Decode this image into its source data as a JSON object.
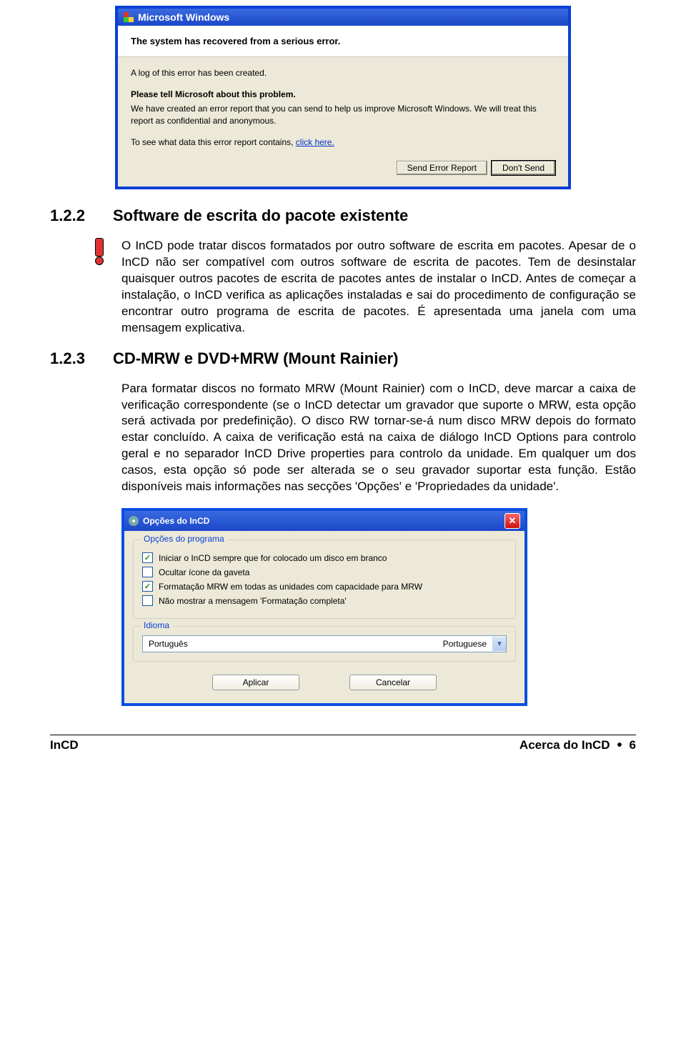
{
  "error_dialog": {
    "title": "Microsoft Windows",
    "header_bold": "The system has recovered from a serious error.",
    "log_line": "A log of this error has been created.",
    "tell_bold": "Please tell Microsoft about this problem.",
    "tell_body": "We have created an error report that you can send to help us improve Microsoft Windows.  We will treat this report as confidential and anonymous.",
    "see_prefix": "To see what data this error report contains, ",
    "see_link": "click here.",
    "btn_send": "Send Error Report",
    "btn_dont": "Don't Send"
  },
  "section_122": {
    "number": "1.2.2",
    "title": "Software de escrita do pacote existente",
    "body": "O InCD pode tratar discos formatados por outro software de escrita em pacotes. Apesar de o InCD não ser compatível com outros software de escrita de pacotes. Tem de desinstalar quaisquer outros pacotes de escrita de pacotes antes de instalar o InCD. Antes de começar a instalação, o InCD verifica as aplicações instaladas e sai do procedimento de configuração se encontrar outro programa de escrita de pacotes. É apresentada uma janela com uma mensagem explicativa."
  },
  "section_123": {
    "number": "1.2.3",
    "title": "CD-MRW e DVD+MRW (Mount Rainier)",
    "body": "Para formatar discos no formato MRW (Mount Rainier) com o InCD, deve marcar a caixa de verificação correspondente (se o InCD detectar um gravador que suporte o MRW, esta opção será activada por predefinição). O disco RW tornar-se-á num disco MRW depois do formato estar concluído. A caixa de verificação está na caixa de diálogo InCD Options para controlo geral e no separador InCD Drive properties para controlo da unidade. Em qualquer um dos casos, esta opção só pode ser alterada se o seu gravador suportar esta função. Estão disponíveis mais informações nas secções 'Opções' e 'Propriedades da unidade'."
  },
  "options_dialog": {
    "title": "Opções do InCD",
    "group_program": "Opções do programa",
    "checks": [
      {
        "label": "Iniciar o InCD sempre que for colocado um disco em branco",
        "checked": true
      },
      {
        "label": "Ocultar ícone da gaveta",
        "checked": false
      },
      {
        "label": "Formatação MRW em todas as unidades com capacidade para MRW",
        "checked": true
      },
      {
        "label": "Não mostrar a mensagem 'Formatação completa'",
        "checked": false
      }
    ],
    "group_lang": "Idioma",
    "lang_native": "Português",
    "lang_en": "Portuguese",
    "btn_apply": "Aplicar",
    "btn_cancel": "Cancelar"
  },
  "footer": {
    "left": "InCD",
    "right_section": "Acerca do InCD",
    "page": "6"
  }
}
